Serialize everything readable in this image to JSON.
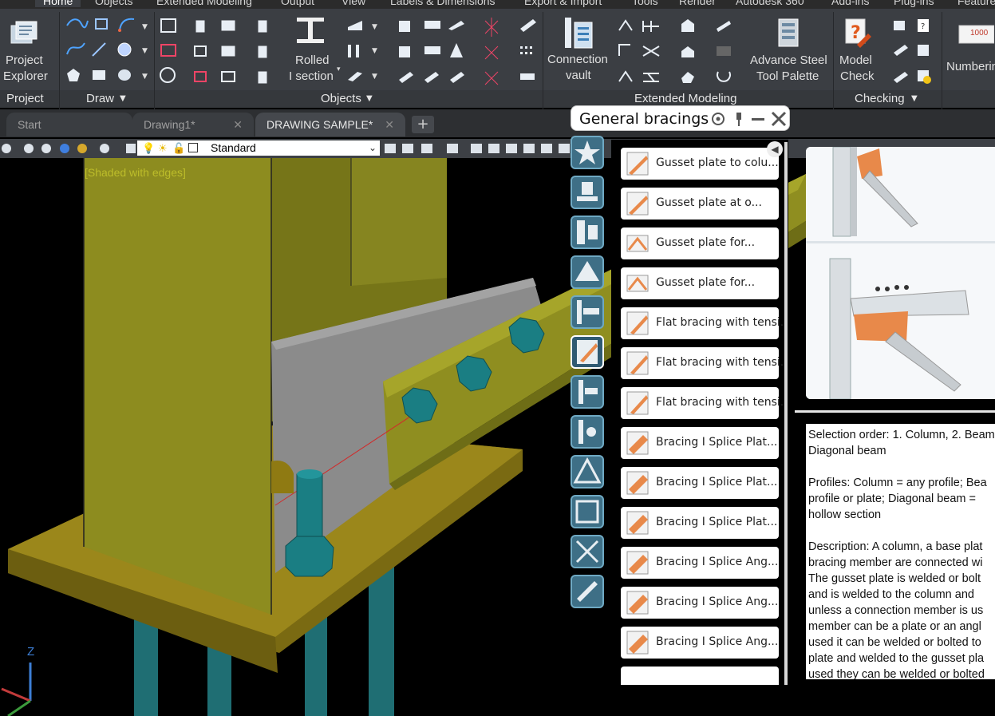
{
  "menu": {
    "items": [
      "Home",
      "Objects",
      "Extended Modeling",
      "Output",
      "View",
      "Labels & Dimensions",
      "Export & Import",
      "Tools",
      "Render",
      "Autodesk 360",
      "Add-ins",
      "Plug-ins",
      "Feature"
    ]
  },
  "ribbon": {
    "project_explorer_line1": "Project",
    "project_explorer_line2": "Explorer",
    "rolled_line1": "Rolled",
    "rolled_line2": "I section",
    "connection_vault_line1": "Connection",
    "connection_vault_line2": "vault",
    "tool_palette_line1": "Advance Steel",
    "tool_palette_line2": "Tool Palette",
    "model_check_line1": "Model",
    "model_check_line2": "Check",
    "numbering_label": "Numbering",
    "numbering_icon_text": "1000",
    "panels": {
      "project": "Project",
      "draw": "Draw",
      "objects": "Objects",
      "extended_modeling": "Extended Modeling",
      "checking": "Checking"
    }
  },
  "tabs": {
    "start": "Start",
    "drawing1": "Drawing1*",
    "drawing_sample": "DRAWING SAMPLE*",
    "close_glyph": "✕",
    "new_tab_glyph": "+"
  },
  "toolbar": {
    "layer_name": "Standard"
  },
  "viewport": {
    "visual_style_label": "[Shaded with edges]",
    "axis_z_label": "Z"
  },
  "palette": {
    "title": "General bracings",
    "items": [
      "Gusset plate to colu...",
      "Gusset plate at o...",
      "Gusset plate for...",
      "Gusset plate for...",
      "Flat bracing with tensi...",
      "Flat bracing with tensi...",
      "Flat bracing with tensi...",
      "Bracing I Splice Plat...",
      "Bracing I Splice Plat...",
      "Bracing I Splice Plat...",
      "Bracing I Splice Ang...",
      "Bracing I Splice Ang...",
      "Bracing I Splice Ang..."
    ],
    "description": {
      "p1_l1": "Selection order: 1. Column, 2. Beam",
      "p1_l2": "Diagonal beam",
      "p2_l1": "Profiles: Column = any profile; Bea",
      "p2_l2": "profile or plate; Diagonal beam =",
      "p2_l3": "hollow section",
      "p3_l1": "Description: A column, a base plat",
      "p3_l2": "bracing member are connected wi",
      "p3_l3": "The gusset plate is welded or bolt",
      "p3_l4": "and is welded to the column and",
      "p3_l5": "unless a connection member is us",
      "p3_l6": "member can be a plate or an angl",
      "p3_l7": "used it can be welded or bolted to",
      "p3_l8": "plate and welded to the gusset pla",
      "p3_l9": "used they can be welded or bolted"
    }
  },
  "colors": {
    "ribbon_bg": "#3b3e43",
    "steel_yellow": "#8e8d1c",
    "plate_olive": "#8a7a1c",
    "bolt_teal": "#1f8a8a",
    "palette_accent": "#3e6f86",
    "connection_orange": "#e8894a"
  }
}
